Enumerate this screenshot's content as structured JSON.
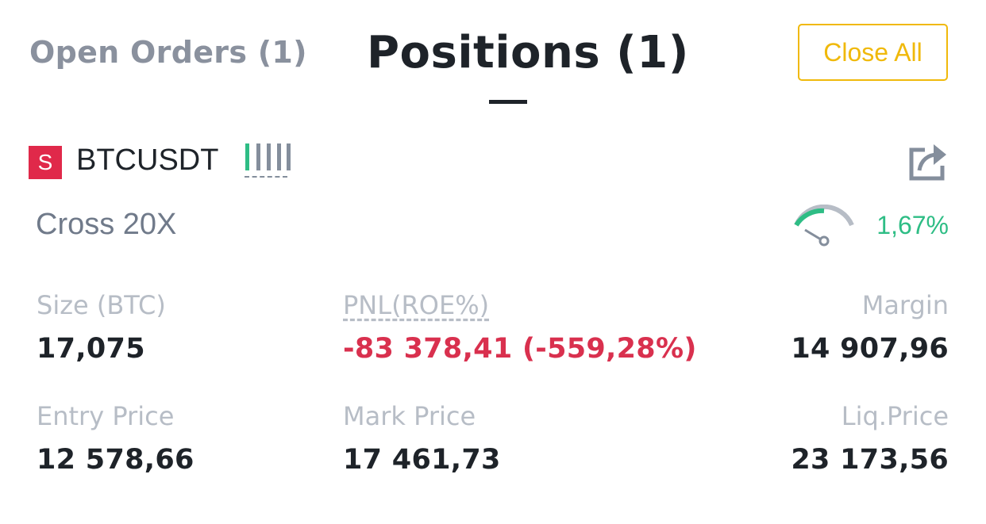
{
  "tabs": {
    "open_orders": "Open Orders (1)",
    "positions": "Positions  (1)"
  },
  "actions": {
    "close_all": "Close All"
  },
  "position": {
    "side_badge": "S",
    "symbol": "BTCUSDT",
    "margin_type": "Cross 20X",
    "margin_ratio": "1,67%",
    "adl_level_filled": 1,
    "adl_level_total": 5,
    "fields": {
      "size_label": "Size (BTC)",
      "size_value": "17,075",
      "pnl_label": "PNL(ROE%)",
      "pnl_value": "-83 378,41 (-559,28%)",
      "margin_label": "Margin",
      "margin_value": "14 907,96",
      "entry_label": "Entry Price",
      "entry_value": "12 578,66",
      "mark_label": "Mark Price",
      "mark_value": "17 461,73",
      "liq_label": "Liq.Price",
      "liq_value": "23 173,56"
    }
  },
  "colors": {
    "accent": "#f0b90b",
    "short": "#e0294a",
    "negative": "#d9304e",
    "positive": "#2ebd85",
    "text_primary": "#1e2329",
    "text_secondary": "#8a919e"
  },
  "icons": {
    "share": "share-icon",
    "risk": "margin-ratio-gauge-icon",
    "adl": "adl-indicator-icon"
  }
}
